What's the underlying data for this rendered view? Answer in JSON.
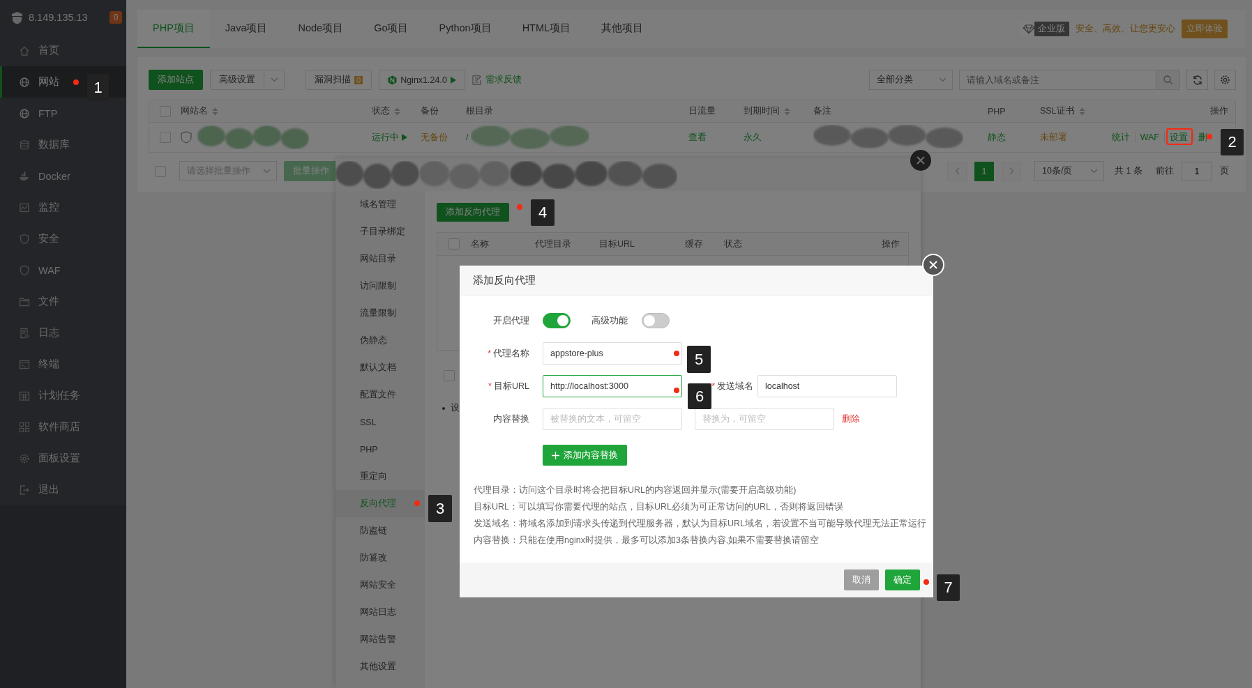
{
  "sidebar": {
    "host": "8.149.135.13",
    "badge": "0",
    "items": [
      {
        "label": "首页",
        "selected": false
      },
      {
        "label": "网站",
        "selected": true
      },
      {
        "label": "FTP",
        "selected": false
      },
      {
        "label": "数据库",
        "selected": false
      },
      {
        "label": "Docker",
        "selected": false
      },
      {
        "label": "监控",
        "selected": false
      },
      {
        "label": "安全",
        "selected": false
      },
      {
        "label": "WAF",
        "selected": false
      },
      {
        "label": "文件",
        "selected": false
      },
      {
        "label": "日志",
        "selected": false
      },
      {
        "label": "终端",
        "selected": false
      },
      {
        "label": "计划任务",
        "selected": false
      },
      {
        "label": "软件商店",
        "selected": false
      },
      {
        "label": "面板设置",
        "selected": false
      },
      {
        "label": "退出",
        "selected": false
      }
    ]
  },
  "project_tabs": [
    {
      "label": "PHP项目",
      "selected": true
    },
    {
      "label": "Java项目",
      "selected": false
    },
    {
      "label": "Node项目",
      "selected": false
    },
    {
      "label": "Go项目",
      "selected": false
    },
    {
      "label": "Python项目",
      "selected": false
    },
    {
      "label": "HTML项目",
      "selected": false
    },
    {
      "label": "其他项目",
      "selected": false
    }
  ],
  "promo": {
    "edition": "企业版",
    "slogan": "安全、高效、让您更安心",
    "button": "立即体验"
  },
  "toolbar": {
    "add_site": "添加站点",
    "advanced": "高级设置",
    "scan": "漏洞扫描",
    "scan_count": "0",
    "nginx": "Nginx1.24.0",
    "feedback": "需求反馈",
    "category": "全部分类",
    "search_placeholder": "请输入域名或备注"
  },
  "sites_table": {
    "columns": [
      {
        "label": "网站名",
        "sortable": true
      },
      {
        "label": "状态",
        "sortable": true
      },
      {
        "label": "备份",
        "sortable": false
      },
      {
        "label": "根目录",
        "sortable": false
      },
      {
        "label": "日流量",
        "sortable": false
      },
      {
        "label": "到期时间",
        "sortable": true
      },
      {
        "label": "备注",
        "sortable": false
      },
      {
        "label": "PHP",
        "sortable": false
      },
      {
        "label": "SSL证书",
        "sortable": true
      },
      {
        "label": "操作",
        "sortable": false
      }
    ],
    "header_checked": false,
    "rows": [
      {
        "checked": false,
        "status": "运行中",
        "backup": "无备份",
        "root": "/",
        "traffic": "查看",
        "expires": "永久",
        "php": "静态",
        "ssl": "未部署",
        "actions": [
          "统计",
          "WAF",
          "设置",
          "删"
        ]
      }
    ]
  },
  "batch": {
    "checked": false,
    "placeholder": "请选择批量操作",
    "button": "批量操作"
  },
  "pagination": {
    "pages": [
      {
        "label": "1",
        "selected": true
      }
    ],
    "per_page": "10条/页",
    "total": "共 1 条",
    "goto": "前往",
    "page_value": "1",
    "page_unit": "页"
  },
  "site_settings": {
    "menu": [
      {
        "label": "域名管理",
        "selected": false
      },
      {
        "label": "子目录绑定",
        "selected": false
      },
      {
        "label": "网站目录",
        "selected": false
      },
      {
        "label": "访问限制",
        "selected": false
      },
      {
        "label": "流量限制",
        "selected": false
      },
      {
        "label": "伪静态",
        "selected": false
      },
      {
        "label": "默认文档",
        "selected": false
      },
      {
        "label": "配置文件",
        "selected": false
      },
      {
        "label": "SSL",
        "selected": false
      },
      {
        "label": "PHP",
        "selected": false
      },
      {
        "label": "重定向",
        "selected": false
      },
      {
        "label": "反向代理",
        "selected": true
      },
      {
        "label": "防盗链",
        "selected": false
      },
      {
        "label": "防篡改",
        "selected": false
      },
      {
        "label": "网站安全",
        "selected": false
      },
      {
        "label": "网站日志",
        "selected": false
      },
      {
        "label": "网站告警",
        "selected": false
      },
      {
        "label": "其他设置",
        "selected": false
      }
    ],
    "add_proxy": "添加反向代理",
    "header_checked": false,
    "footer_checked": false,
    "columns": [
      "名称",
      "代理目录",
      "目标URL",
      "缓存",
      "状态",
      "操作"
    ],
    "note": "设"
  },
  "modal": {
    "title": "添加反向代理",
    "switches": [
      {
        "label": "开启代理",
        "on": true
      },
      {
        "label": "高级功能",
        "on": false
      }
    ],
    "fields": [
      {
        "label": "代理名称",
        "required": true,
        "required_mark": "*",
        "value": "appstore-plus",
        "focused": false
      },
      {
        "label": "目标URL",
        "required": true,
        "required_mark": "*",
        "value": "http://localhost:3000",
        "focused": true,
        "side": {
          "label": "发送域名",
          "required": true,
          "required_mark": "*",
          "value": "localhost"
        }
      }
    ],
    "replace": {
      "label": "内容替换",
      "from_placeholder": "被替换的文本，可留空",
      "to_placeholder": "替换为，可留空",
      "delete": "删除"
    },
    "add_replace": "添加内容替换",
    "notes": [
      "代理目录：访问这个目录时将会把目标URL的内容返回并显示(需要开启高级功能)",
      "目标URL：可以填写你需要代理的站点，目标URL必须为可正常访问的URL，否则将返回错误",
      "发送域名：将域名添加到请求头传递到代理服务器，默认为目标URL域名，若设置不当可能导致代理无法正常运行",
      "内容替换：只能在使用nginx时提供，最多可以添加3条替换内容,如果不需要替换请留空"
    ],
    "cancel": "取消",
    "confirm": "确定"
  },
  "annotations": [
    {
      "number": "1",
      "outline": false
    },
    {
      "number": "2",
      "outline": true
    },
    {
      "number": "3",
      "outline": false
    },
    {
      "number": "4",
      "outline": false
    },
    {
      "number": "5",
      "outline": false
    },
    {
      "number": "6",
      "outline": false
    },
    {
      "number": "7",
      "outline": false
    }
  ]
}
